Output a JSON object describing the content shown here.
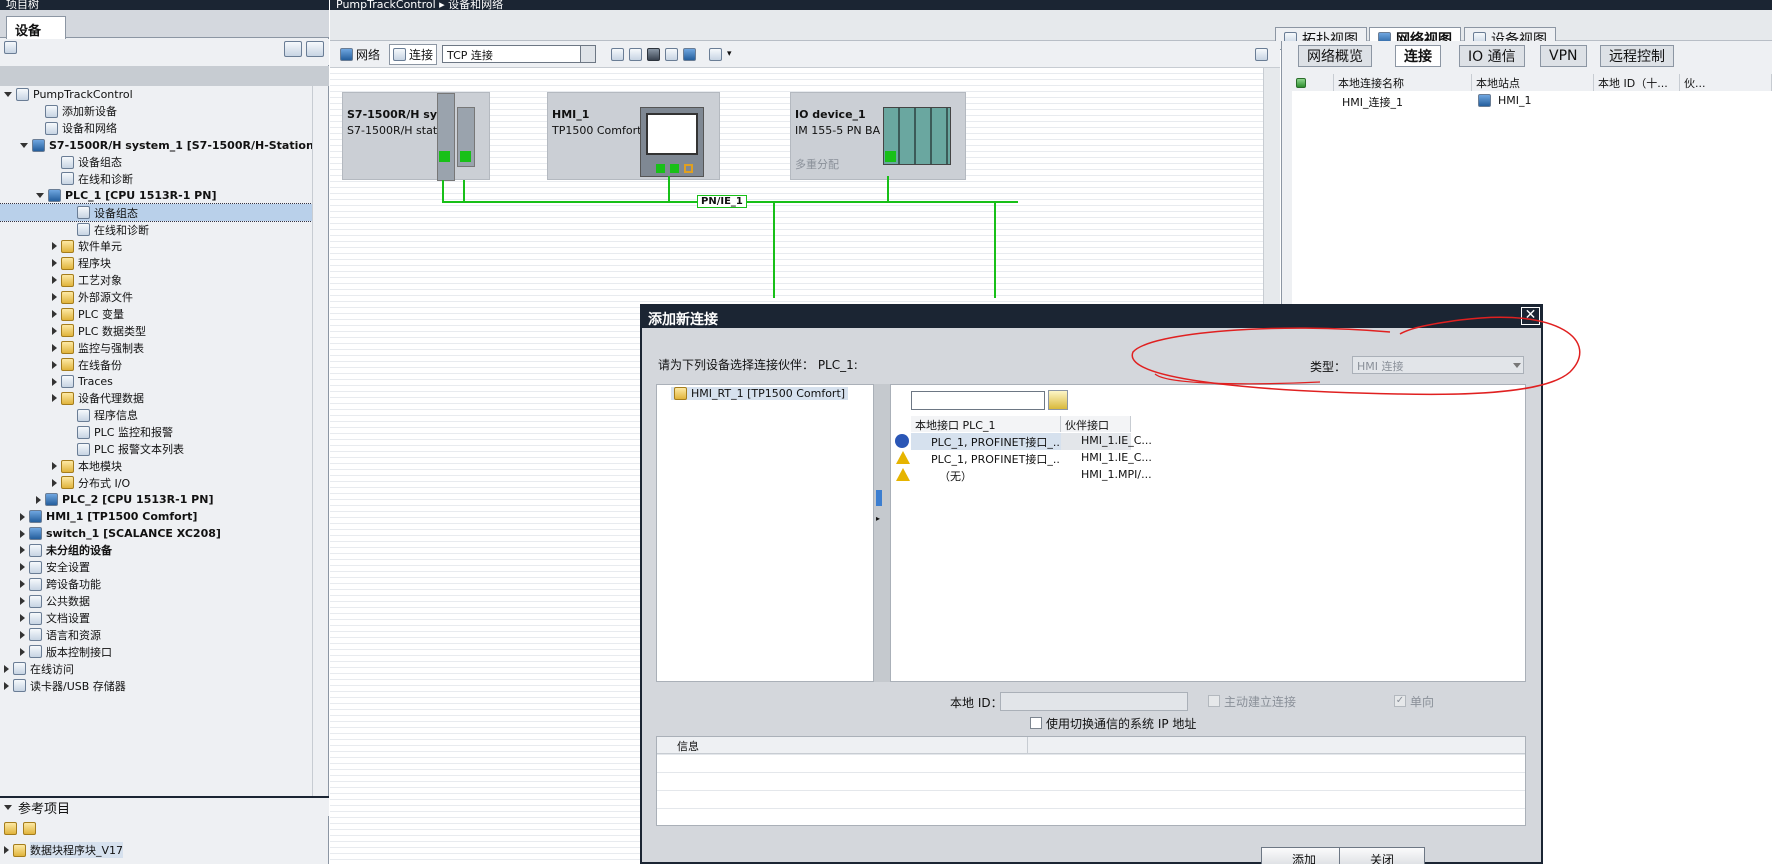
{
  "left_panel": {
    "title": "项目树",
    "tab": "设备",
    "tree": [
      {
        "label": "PumpTrackControl",
        "indent": 0,
        "state": "open",
        "icon": "project-icon"
      },
      {
        "label": "添加新设备",
        "indent": 2,
        "state": "none",
        "icon": "add-device-icon"
      },
      {
        "label": "设备和网络",
        "indent": 2,
        "state": "none",
        "icon": "network-icon"
      },
      {
        "label": "S7-1500R/H system_1 [S7-1500R/H-Station]",
        "indent": 1,
        "state": "open",
        "icon": "station-icon",
        "bold": true
      },
      {
        "label": "设备组态",
        "indent": 3,
        "state": "none",
        "icon": "device-config-icon"
      },
      {
        "label": "在线和诊断",
        "indent": 3,
        "state": "none",
        "icon": "diagnostics-icon"
      },
      {
        "label": "PLC_1 [CPU 1513R-1 PN]",
        "indent": 2,
        "state": "open",
        "icon": "cpu-icon",
        "bold": true
      },
      {
        "label": "设备组态",
        "indent": 4,
        "state": "none",
        "icon": "device-config-icon",
        "selected": true
      },
      {
        "label": "在线和诊断",
        "indent": 4,
        "state": "none",
        "icon": "diagnostics-icon"
      },
      {
        "label": "软件单元",
        "indent": 3,
        "state": "closed",
        "icon": "software-unit-icon"
      },
      {
        "label": "程序块",
        "indent": 3,
        "state": "closed",
        "icon": "program-blocks-icon"
      },
      {
        "label": "工艺对象",
        "indent": 3,
        "state": "closed",
        "icon": "technology-object-icon"
      },
      {
        "label": "外部源文件",
        "indent": 3,
        "state": "closed",
        "icon": "folder-icon"
      },
      {
        "label": "PLC 变量",
        "indent": 3,
        "state": "closed",
        "icon": "folder-icon"
      },
      {
        "label": "PLC 数据类型",
        "indent": 3,
        "state": "closed",
        "icon": "folder-icon"
      },
      {
        "label": "监控与强制表",
        "indent": 3,
        "state": "closed",
        "icon": "folder-icon"
      },
      {
        "label": "在线备份",
        "indent": 3,
        "state": "closed",
        "icon": "folder-icon"
      },
      {
        "label": "Traces",
        "indent": 3,
        "state": "closed",
        "icon": "traces-icon"
      },
      {
        "label": "设备代理数据",
        "indent": 3,
        "state": "closed",
        "icon": "folder-icon"
      },
      {
        "label": "程序信息",
        "indent": 4,
        "state": "none",
        "icon": "program-info-icon"
      },
      {
        "label": "PLC 监控和报警",
        "indent": 4,
        "state": "none",
        "icon": "alarm-icon"
      },
      {
        "label": "PLC 报警文本列表",
        "indent": 4,
        "state": "none",
        "icon": "text-list-icon"
      },
      {
        "label": "本地模块",
        "indent": 3,
        "state": "closed",
        "icon": "folder-icon"
      },
      {
        "label": "分布式 I/O",
        "indent": 3,
        "state": "closed",
        "icon": "folder-icon"
      },
      {
        "label": "PLC_2 [CPU 1513R-1 PN]",
        "indent": 2,
        "state": "closed",
        "icon": "cpu-icon",
        "bold": true
      },
      {
        "label": "HMI_1 [TP1500 Comfort]",
        "indent": 1,
        "state": "closed",
        "icon": "hmi-icon",
        "bold": true
      },
      {
        "label": "switch_1 [SCALANCE XC208]",
        "indent": 1,
        "state": "closed",
        "icon": "switch-icon",
        "bold": true
      },
      {
        "label": "未分组的设备",
        "indent": 1,
        "state": "closed",
        "icon": "ungrouped-icon",
        "bold": true
      },
      {
        "label": "安全设置",
        "indent": 1,
        "state": "closed",
        "icon": "security-icon"
      },
      {
        "label": "跨设备功能",
        "indent": 1,
        "state": "closed",
        "icon": "cross-device-icon"
      },
      {
        "label": "公共数据",
        "indent": 1,
        "state": "closed",
        "icon": "common-data-icon"
      },
      {
        "label": "文档设置",
        "indent": 1,
        "state": "closed",
        "icon": "document-icon"
      },
      {
        "label": "语言和资源",
        "indent": 1,
        "state": "closed",
        "icon": "language-icon"
      },
      {
        "label": "版本控制接口",
        "indent": 1,
        "state": "closed",
        "icon": "version-control-icon"
      },
      {
        "label": "在线访问",
        "indent": 0,
        "state": "closed",
        "icon": "online-access-icon"
      },
      {
        "label": "读卡器/USB 存储器",
        "indent": 0,
        "state": "closed",
        "icon": "card-reader-icon"
      }
    ],
    "reference": {
      "title": "参考项目",
      "item": "数据块程序块_V17"
    }
  },
  "main": {
    "breadcrumb": "PumpTrackControl ▸ 设备和网络",
    "view_tabs": [
      "拓扑视图",
      "网络视图",
      "设备视图"
    ],
    "active_view": "网络视图",
    "toolbar": {
      "network_label": "网络",
      "connection_label": "连接",
      "connection_type": "TCP 连接"
    },
    "devices": [
      {
        "name": "S7-1500R/H sys...",
        "model": "S7-1500R/H  stat..."
      },
      {
        "name": "HMI_1",
        "model": "TP1500 Comfort"
      },
      {
        "name": "IO device_1",
        "model": "IM 155-5 PN BA",
        "extra": "多重分配"
      }
    ],
    "subnet_label": "PN/IE_1"
  },
  "right_panel": {
    "tabs": [
      "网络概览",
      "连接",
      "IO 通信",
      "VPN",
      "远程控制"
    ],
    "active_tab": "连接",
    "columns": [
      "本地连接名称",
      "本地站点",
      "本地 ID（十...",
      "伙..."
    ],
    "rows": [
      {
        "name": "HMI_连接_1",
        "station": "HMI_1"
      }
    ]
  },
  "dialog": {
    "title": "添加新连接",
    "prompt": "请为下列设备选择连接伙伴： PLC_1:",
    "type_label": "类型：",
    "type_value": "HMI 连接",
    "partner": "HMI_RT_1 [TP1500 Comfort]",
    "list_columns": [
      "本地接口 PLC_1",
      "伙伴接口"
    ],
    "list_rows": [
      {
        "status": "ok",
        "local": "PLC_1, PROFINET接口_...",
        "partner": "HMI_1.IE_C..."
      },
      {
        "status": "warning",
        "local": "PLC_1, PROFINET接口_...",
        "partner": "HMI_1.IE_C..."
      },
      {
        "status": "warning",
        "local": "（无）",
        "partner": "HMI_1.MPI/..."
      }
    ],
    "local_id_label": "本地 ID：",
    "active_connect_label": "主动建立连接",
    "one_way_label": "单向",
    "use_switch_ip_label": "使用切换通信的系统 IP 地址",
    "info_label": "信息",
    "add_button": "添加",
    "close_button": "关闭"
  },
  "colors": {
    "title_bar": "#1b2533",
    "subnet": "#18c018",
    "annotation": "#e02020",
    "selection": "#b9d0ea"
  }
}
